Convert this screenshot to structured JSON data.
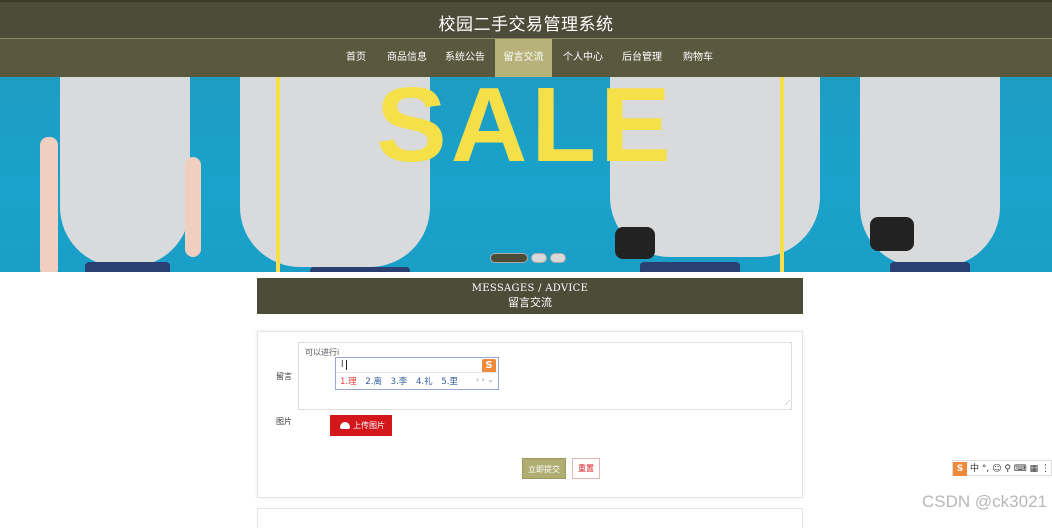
{
  "header": {
    "title": "校园二手交易管理系统"
  },
  "nav": {
    "items": [
      {
        "label": "首页"
      },
      {
        "label": "商品信息"
      },
      {
        "label": "系统公告"
      },
      {
        "label": "留言交流"
      },
      {
        "label": "个人中心"
      },
      {
        "label": "后台管理"
      },
      {
        "label": "购物车"
      }
    ],
    "active_index": 3
  },
  "banner": {
    "text": "SALE",
    "slide_count": 3,
    "active_slide": 1
  },
  "messages": {
    "title_en": "MESSAGES / ADVICE",
    "title_cn": "留言交流"
  },
  "form": {
    "message_label": "留言",
    "message_value": "可以进行i",
    "image_label": "图片",
    "upload_label": "上传图片",
    "submit_label": "立即提交",
    "reset_label": "重置"
  },
  "ime": {
    "composition": "l",
    "candidates": [
      "1.理",
      "2.离",
      "3.李",
      "4.礼",
      "5.里"
    ],
    "logo": "S",
    "toolbar": "中 °, ☺ ⚲ ⌨ ▦ ⋮"
  },
  "watermark": "CSDN @ck3021",
  "colors": {
    "header": "#4d4c39",
    "nav": "#5a593f",
    "nav_active": "#b6b27a",
    "banner_bg": "#19a2cb",
    "sale_yellow": "#f6e04a",
    "upload_red": "#d4171b",
    "submit_olive": "#b0ad72"
  }
}
